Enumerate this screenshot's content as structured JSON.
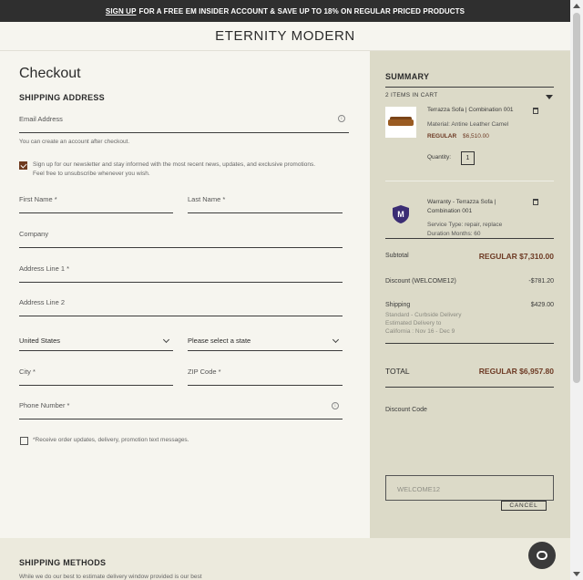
{
  "promo": {
    "link": "SIGN UP",
    "text": "FOR A FREE EM INSIDER ACCOUNT & SAVE UP TO 18% ON REGULAR PRICED PRODUCTS"
  },
  "brand": "ETERNITY MODERN",
  "checkout": {
    "title": "Checkout",
    "shipping_address_heading": "SHIPPING ADDRESS",
    "email_label": "Email Address",
    "email_note": "You can create an account after checkout.",
    "newsletter_text": "Sign up for our newsletter and stay informed with the most recent news, updates, and exclusive promotions. Feel free to unsubscribe whenever you wish.",
    "first_name": "First Name *",
    "last_name": "Last Name *",
    "company": "Company",
    "address1": "Address Line 1 *",
    "address2": "Address Line 2",
    "country": "United States",
    "state": "Please select a state",
    "city": "City *",
    "zip": "ZIP Code *",
    "phone": "Phone Number *",
    "sms_text": "*Receive order updates, delivery, promotion text messages."
  },
  "summary": {
    "heading": "SUMMARY",
    "items_count": "2  ITEMS IN CART",
    "item1": {
      "name": "Terrazza Sofa | Combination 001",
      "material": "Material:  Antine Leather Camel",
      "price_label": "REGULAR",
      "price": "$6,510.00",
      "qty_label": "Quantity:",
      "qty": "1"
    },
    "item2": {
      "name": "Warranty - Terrazza Sofa | Combination 001",
      "service": "Service Type:   repair, replace",
      "duration": "Duration Months:   60"
    },
    "subtotal_label": "Subtotal",
    "subtotal": "REGULAR $7,310.00",
    "discount_label": "Discount (WELCOME12)",
    "discount": "-$781.20",
    "shipping_label": "Shipping",
    "shipping": "$429.00",
    "shipping_detail": "Standard - Curbside Delivery",
    "shipping_est": "Estimated Delivery to",
    "shipping_dates": "California : Nov 16 - Dec 9",
    "total_label": "TOTAL",
    "total": "REGULAR $6,957.80",
    "discount_code_label": "Discount Code",
    "discount_code_value": "WELCOME12",
    "cancel_label": "CANCEL"
  },
  "shipping_methods": {
    "heading": "SHIPPING METHODS",
    "note": "While we do our best to estimate delivery window provided is our best"
  },
  "icons": [
    "info-icon",
    "chevron-down-icon",
    "trash-icon",
    "shield-icon",
    "chat-icon"
  ]
}
